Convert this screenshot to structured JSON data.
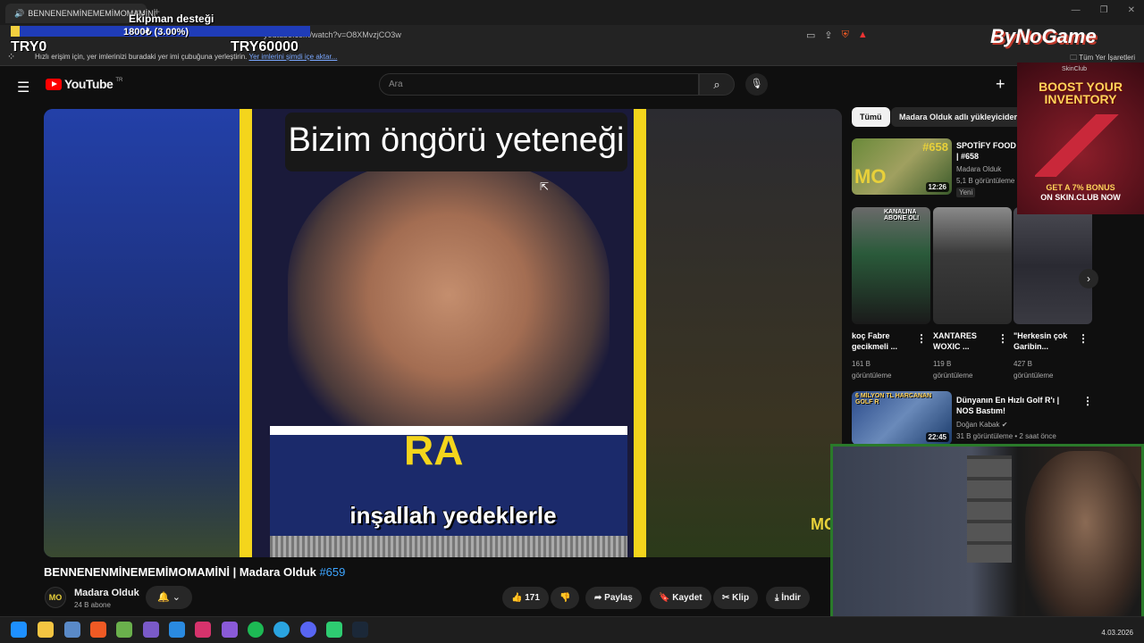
{
  "browser": {
    "tab_title": "BENNENENMİNEMEMİMOMAMİNİ",
    "close_tab": "×",
    "new_tab": "+",
    "url": "youtube.com/watch?v=O8XMvzjCO3w",
    "bookmark_message": "Hızlı erişim için, yer imlerinizi buradaki yer imi çubuğuna yerleştirin.",
    "bookmark_import": "Yer imlerini şimdi içe aktar...",
    "all_bookmarks": "Tüm Yer İşaretleri",
    "window_controls": [
      "—",
      "❐",
      "✕"
    ]
  },
  "overlay": {
    "donation_title": "Ekipman desteği",
    "donation_amount": "1800₺ (3.00%)",
    "donation_progress": 0.03,
    "donation_min": "TRY0",
    "donation_max": "TRY60000",
    "brand_logo": "ByNoGame"
  },
  "youtube": {
    "logo": "YouTube",
    "region": "TR",
    "search_placeholder": "Ara",
    "create_icon": "+"
  },
  "video": {
    "caption_top": "Bizim öngörü yeteneği",
    "caption_bottom": "inşallah yedeklerle",
    "emblem": "RA",
    "watermark": "MO",
    "title": "BENNENENMİNEMEMİMOMAMİNİ | Madara Olduk ",
    "hashtag": "#659",
    "channel_name": "Madara Olduk",
    "channel_subs": "24 B abone",
    "channel_avatar": "MO",
    "likes": "171",
    "share": "Paylaş",
    "save": "Kaydet",
    "clip": "Klip",
    "download": "İndir"
  },
  "sidebar": {
    "chips": [
      "Tümü",
      "Madara Olduk adlı yükleyiciden"
    ],
    "rec1": {
      "title": "SPOTİFY FOOD | #658",
      "channel": "Madara Olduk",
      "views": "5,1 B görüntüleme",
      "badge": "Yeni",
      "duration": "12:26",
      "thumb_text": "#658"
    },
    "shorts": [
      {
        "title": "koç Fabre gecikmeli ...",
        "views": "161 B",
        "views_unit": "görüntüleme",
        "thumb_text": "KANALINA ABONE OL!"
      },
      {
        "title": "XANTARES WOXIC ...",
        "views": "119 B",
        "views_unit": "görüntüleme",
        "thumb_text": ""
      },
      {
        "title": "\"Herkesin çok Garibin...",
        "views": "427 B",
        "views_unit": "görüntüleme",
        "thumb_text": ""
      }
    ],
    "rec2": {
      "title": "Dünyanın En Hızlı Golf R'ı | NOS Bastım!",
      "channel": "Doğan Kabak",
      "meta": "31 B görüntüleme • 2 saat önce",
      "duration": "22:45",
      "thumb_text": "6 MİLYON TL HARCANAN GOLF R"
    }
  },
  "ad": {
    "brand": "SkinClub",
    "headline": "BOOST YOUR INVENTORY",
    "cta_line1": "GET A 7% BONUS",
    "cta_line2": "ON SKIN.CLUB NOW"
  },
  "taskbar": {
    "date": "4.03.2026"
  },
  "colors": {
    "youtube_red": "#ff0000",
    "link_blue": "#3ea6ff",
    "donation_bar": "#1f3cb8",
    "donation_fill": "#f4d03f",
    "webcam_border": "#2a7a2a"
  }
}
